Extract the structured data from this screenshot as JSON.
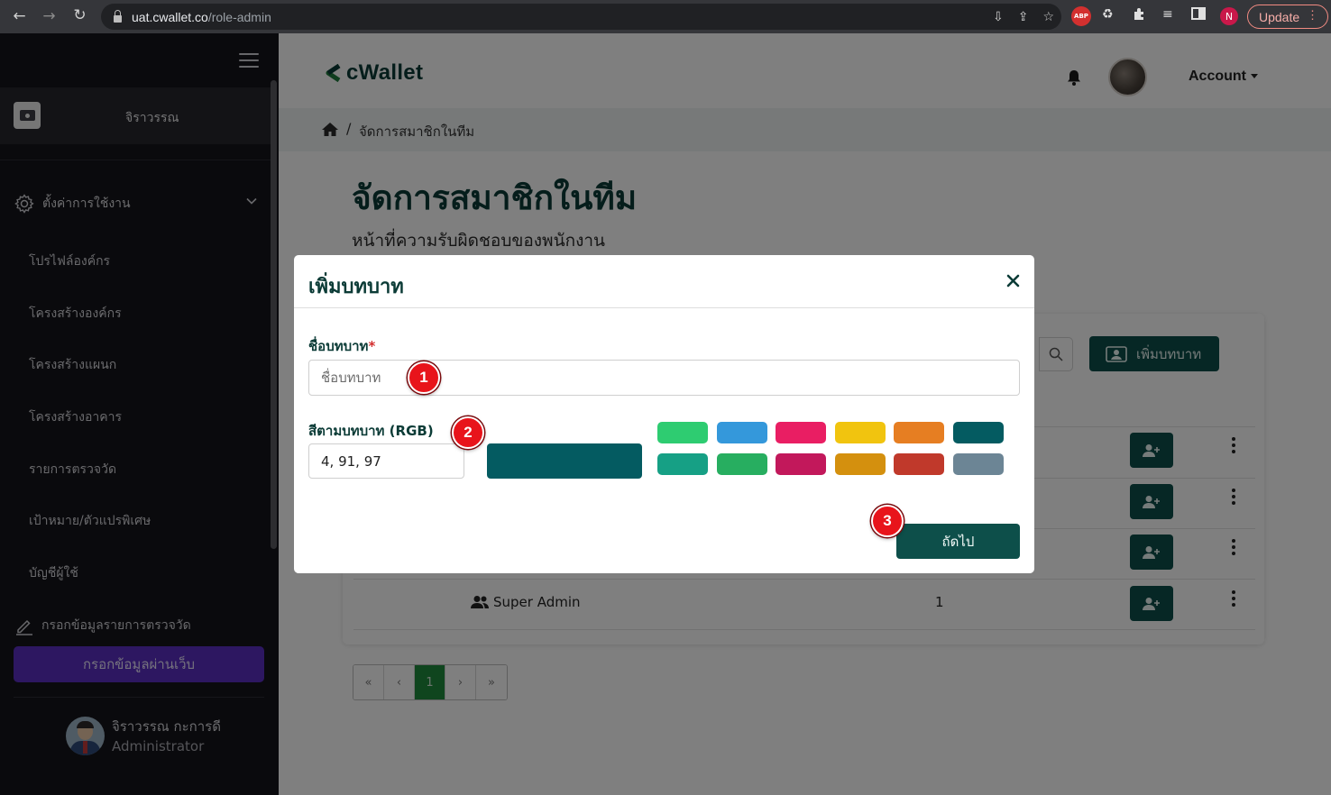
{
  "browser": {
    "url_host": "uat.cwallet.co",
    "url_path": "/role-admin",
    "abp_label": "ABP",
    "profile_initial": "N",
    "update_label": "Update"
  },
  "sidebar": {
    "user_name": "จิราวรรณ",
    "settings_label": "ตั้งค่าการใช้งาน",
    "items": [
      {
        "label": "โปรไฟล์องค์กร"
      },
      {
        "label": "โครงสร้างองค์กร"
      },
      {
        "label": "โครงสร้างแผนก"
      },
      {
        "label": "โครงสร้างอาคาร"
      },
      {
        "label": "รายการตรวจวัด"
      },
      {
        "label": "เป้าหมาย/ตัวแปรพิเศษ"
      },
      {
        "label": "บัญชีผู้ใช้"
      }
    ],
    "data_entry_label": "กรอกข้อมูลรายการตรวจวัด",
    "web_entry_button": "กรอกข้อมูลผ่านเว็บ",
    "footer_user_name": "จิราวรรณ กะการดี",
    "footer_user_role": "Administrator"
  },
  "header": {
    "logo_text": "cWallet",
    "account_label": "Account"
  },
  "breadcrumb": {
    "current": "จัดการสมาชิกในทีม"
  },
  "page": {
    "title": "จัดการสมาชิกในทีม",
    "subtitle": "หน้าที่ความรับผิดชอบของพนักงาน",
    "add_role_button": "เพิ่มบทบาท",
    "visible_row": {
      "name": "Super Admin",
      "count": "1"
    }
  },
  "pagination": {
    "first": "«",
    "prev": "‹",
    "current": "1",
    "next": "›",
    "last": "»"
  },
  "modal": {
    "title": "เพิ่มบทบาท",
    "name_label": "ชื่อบทบาท",
    "required_mark": "*",
    "name_placeholder": "ชื่อบทบาท",
    "name_value": "",
    "color_label": "สีตามบทบาท (RGB)",
    "rgb_value": "4, 91, 97",
    "preview_color": "#045b61",
    "swatches": [
      "#2ecc71",
      "#3498db",
      "#e91e63",
      "#f1c40f",
      "#e67e22",
      "#045b61",
      "#16a085",
      "#27ae60",
      "#c2185b",
      "#d4900e",
      "#c0392b",
      "#6c8595"
    ],
    "next_button": "ถัดไป"
  },
  "annotations": {
    "step1": "1",
    "step2": "2",
    "step3": "3"
  },
  "colors": {
    "primary": "#0d4f4a",
    "title": "#0b3b36",
    "sidebar_bg": "#15151a",
    "web_button": "#5a2fc2",
    "active_page": "#1f8a3d",
    "badge": "#e8141b"
  }
}
